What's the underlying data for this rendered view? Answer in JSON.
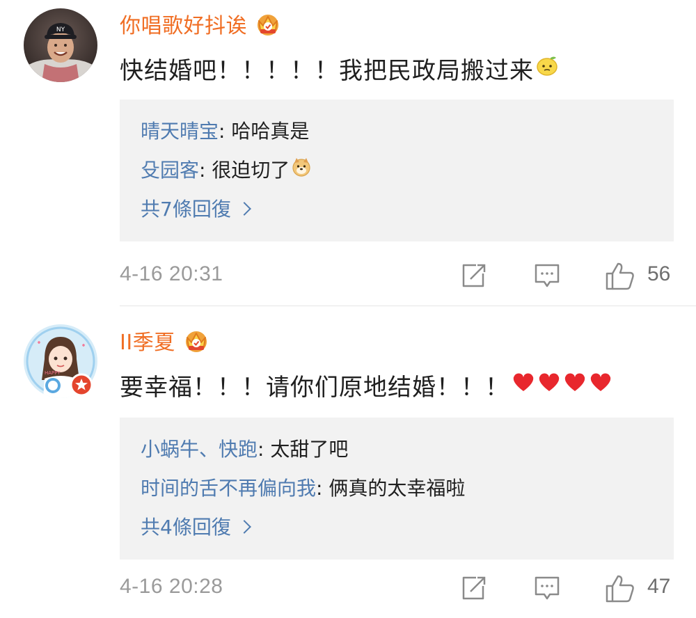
{
  "comments": [
    {
      "username": "你唱歌好抖诶",
      "badge_icon": "crown-vip-icon",
      "text": "快结婚吧！！！！！我把民政局搬过来",
      "text_emoji": "lemon-face-emoji",
      "replies": [
        {
          "name": "晴天晴宝",
          "text": ": 哈哈真是"
        },
        {
          "name": "殳园客",
          "text": ": 很迫切了",
          "emoji": "doge-emoji"
        }
      ],
      "more_replies": "共7條回復",
      "timestamp": "4-16 20:31",
      "like_count": "56"
    },
    {
      "username": "II季夏",
      "badge_icon": "crown-vip-icon",
      "text": "要幸福！！！请你们原地结婚！！！",
      "text_emoji": "four-red-hearts",
      "replies": [
        {
          "name": "小蜗牛、快跑",
          "text": ": 太甜了吧"
        },
        {
          "name": "时间的舌不再偏向我",
          "text": ": 俩真的太幸福啦"
        }
      ],
      "more_replies": "共4條回復",
      "timestamp": "4-16 20:28",
      "like_count": "47"
    }
  ],
  "colors": {
    "username": "#f06e24",
    "reply_name": "#4f7bb0",
    "reply_bg": "#f2f2f2",
    "meta": "#9a9a9a"
  }
}
